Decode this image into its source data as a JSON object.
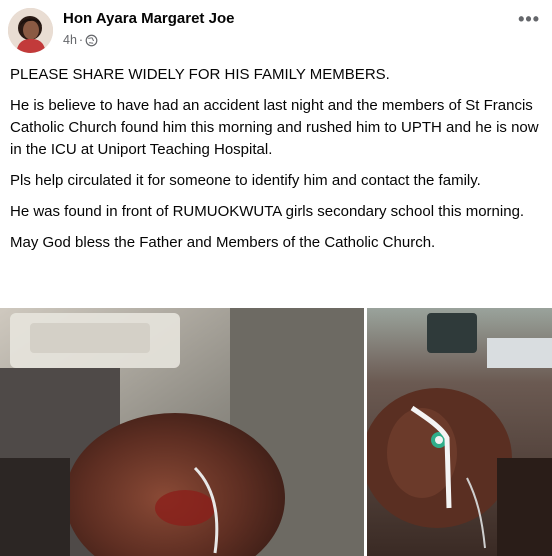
{
  "post": {
    "author": "Hon Ayara Margaret Joe",
    "time": "4h",
    "separator": "·",
    "audience_icon": "globe-icon",
    "more_icon": "more-options-icon",
    "more_label": "•••",
    "paragraphs": [
      "PLEASE SHARE WIDELY FOR HIS FAMILY MEMBERS.",
      "He is believe to have had an accident last night and the members of St Francis Catholic Church found him this morning and rushed him to UPTH and he is now in the ICU at Uniport Teaching Hospital.",
      "Pls help circulated it for someone to identify him and contact the family.",
      "He was found in front of RUMUOKWUTA girls secondary school this morning.",
      "May God bless the Father and Members of the Catholic Church."
    ]
  },
  "colors": {
    "text": "#050505",
    "meta": "#65676b",
    "background": "#ffffff"
  }
}
